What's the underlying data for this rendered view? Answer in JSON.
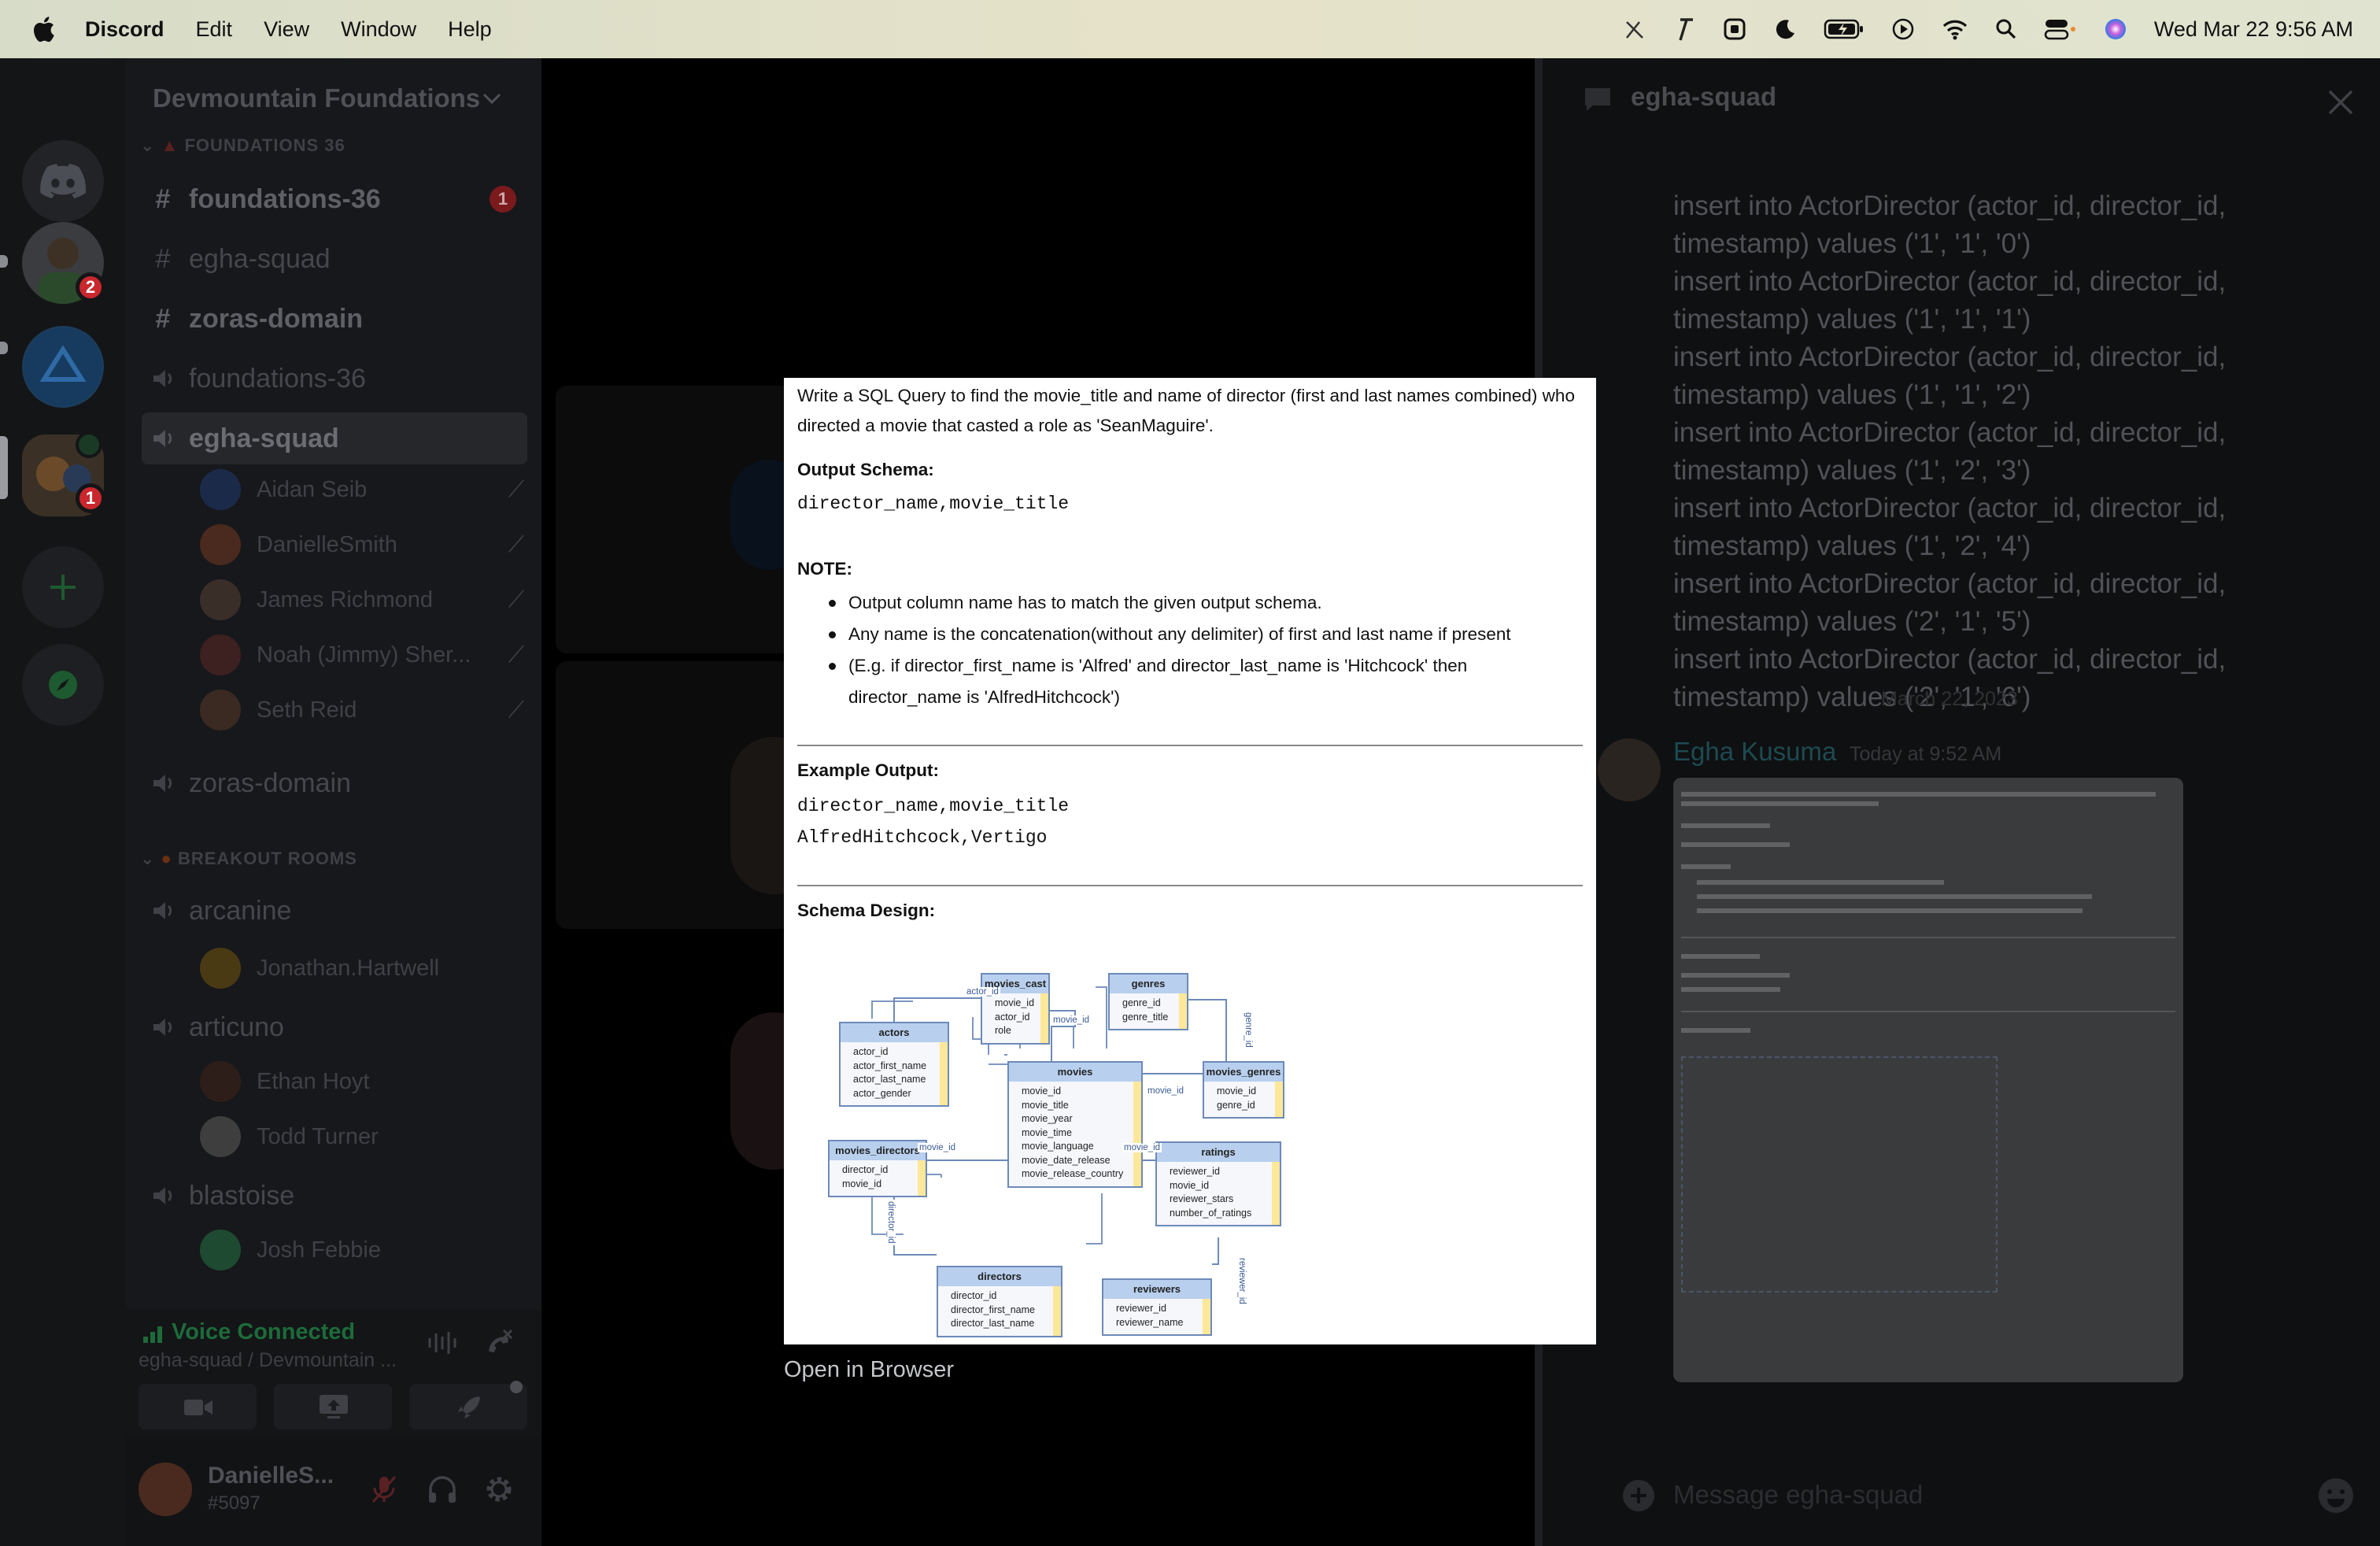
{
  "menubar": {
    "app_name": "Discord",
    "items": [
      "Edit",
      "View",
      "Window",
      "Help"
    ],
    "clock": "Wed Mar 22  9:56 AM"
  },
  "rail": {
    "badges": [
      "2",
      "1"
    ]
  },
  "sidebar": {
    "server_name": "Devmountain Foundations",
    "category_1": "FOUNDATIONS 36",
    "channels": [
      {
        "name": "foundations-36",
        "type": "text",
        "unread": "1"
      },
      {
        "name": "egha-squad",
        "type": "text"
      },
      {
        "name": "zoras-domain",
        "type": "text"
      },
      {
        "name": "foundations-36",
        "type": "voice"
      },
      {
        "name": "egha-squad",
        "type": "voice"
      }
    ],
    "voice_users": [
      "Aidan Seib",
      "DanielleSmith",
      "James Richmond",
      "Noah (Jimmy) Sher...",
      "Seth Reid"
    ],
    "channel_zoras_voice": "zoras-domain",
    "category_2": "BREAKOUT ROOMS",
    "breakout": [
      {
        "name": "arcanine",
        "users": [
          "Jonathan.Hartwell"
        ]
      },
      {
        "name": "articuno",
        "users": [
          "Ethan Hoyt",
          "Todd Turner"
        ]
      },
      {
        "name": "blastoise",
        "users": [
          "Josh Febbie"
        ]
      }
    ],
    "voice_status": "Voice Connected",
    "voice_location": "egha-squad / Devmountain ...",
    "user_name": "DanielleS...",
    "user_tag": "#5097"
  },
  "panel": {
    "title": "egha-squad",
    "sql_lines": [
      "insert into ActorDirector (actor_id, director_id,",
      "timestamp) values ('1', '1', '0')",
      "insert into ActorDirector (actor_id, director_id,",
      "timestamp) values ('1', '1', '1')",
      "insert into ActorDirector (actor_id, director_id,",
      "timestamp) values ('1', '1', '2')",
      "insert into ActorDirector (actor_id, director_id,",
      "timestamp) values ('1', '2', '3')",
      "insert into ActorDirector (actor_id, director_id,",
      "timestamp) values ('1', '2', '4')",
      "insert into ActorDirector (actor_id, director_id,",
      "timestamp) values ('2', '1', '5')",
      "insert into ActorDirector (actor_id, director_id,",
      "timestamp) values ('2', '1', '6')"
    ],
    "date_divider": "March 22, 2023",
    "author": "Egha Kusuma",
    "timestamp": "Today at 9:52 AM",
    "message_placeholder": "Message egha-squad"
  },
  "modal": {
    "question": "Write a SQL Query to find the movie_title and name of director (first and last names combined) who directed a movie that casted a role as 'SeanMaguire'.",
    "output_schema_label": "Output Schema:",
    "output_schema": "director_name,movie_title",
    "note_label": "NOTE:",
    "notes": [
      "Output column name has to match the given output schema.",
      "Any name is the concatenation(without any delimiter) of first and last name if present",
      "(E.g. if director_first_name is 'Alfred' and director_last_name is 'Hitchcock' then director_name is 'AlfredHitchcock')"
    ],
    "example_label": "Example Output:",
    "example_lines": [
      "director_name,movie_title",
      "AlfredHitchcock,Vertigo"
    ],
    "schema_label": "Schema Design:",
    "open_in_browser": "Open in Browser"
  },
  "schema": {
    "tables": {
      "movies_cast": {
        "title": "movies_cast",
        "fields": [
          "movie_id",
          "actor_id",
          "role"
        ]
      },
      "genres": {
        "title": "genres",
        "fields": [
          "genre_id",
          "genre_title"
        ]
      },
      "actors": {
        "title": "actors",
        "fields": [
          "actor_id",
          "actor_first_name",
          "actor_last_name",
          "actor_gender"
        ]
      },
      "movies": {
        "title": "movies",
        "fields": [
          "movie_id",
          "movie_title",
          "movie_year",
          "movie_time",
          "movie_language",
          "movie_date_release",
          "movie_release_country"
        ]
      },
      "movies_genres": {
        "title": "movies_genres",
        "fields": [
          "movie_id",
          "genre_id"
        ]
      },
      "movies_directors": {
        "title": "movies_directors",
        "fields": [
          "director_id",
          "movie_id"
        ]
      },
      "ratings": {
        "title": "ratings",
        "fields": [
          "reviewer_id",
          "movie_id",
          "reviewer_stars",
          "number_of_ratings"
        ]
      },
      "directors": {
        "title": "directors",
        "fields": [
          "director_id",
          "director_first_name",
          "director_last_name"
        ]
      },
      "reviewers": {
        "title": "reviewers",
        "fields": [
          "reviewer_id",
          "reviewer_name"
        ]
      }
    },
    "links": [
      "actor_id",
      "movie_id",
      "genre_id",
      "movie_id",
      "movie_id",
      "movie_id",
      "director_id",
      "reviewer_id"
    ]
  }
}
